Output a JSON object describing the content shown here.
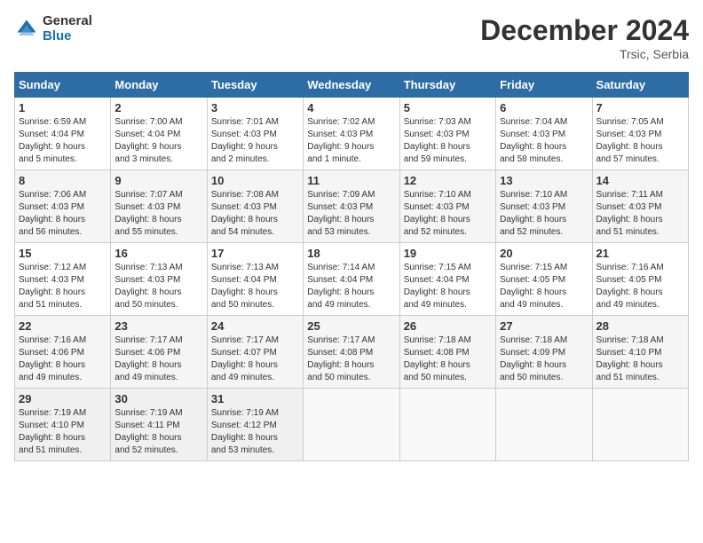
{
  "logo": {
    "general": "General",
    "blue": "Blue"
  },
  "title": "December 2024",
  "location": "Trsic, Serbia",
  "days_header": [
    "Sunday",
    "Monday",
    "Tuesday",
    "Wednesday",
    "Thursday",
    "Friday",
    "Saturday"
  ],
  "weeks": [
    [
      {
        "day": "1",
        "info": "Sunrise: 6:59 AM\nSunset: 4:04 PM\nDaylight: 9 hours\nand 5 minutes."
      },
      {
        "day": "2",
        "info": "Sunrise: 7:00 AM\nSunset: 4:04 PM\nDaylight: 9 hours\nand 3 minutes."
      },
      {
        "day": "3",
        "info": "Sunrise: 7:01 AM\nSunset: 4:03 PM\nDaylight: 9 hours\nand 2 minutes."
      },
      {
        "day": "4",
        "info": "Sunrise: 7:02 AM\nSunset: 4:03 PM\nDaylight: 9 hours\nand 1 minute."
      },
      {
        "day": "5",
        "info": "Sunrise: 7:03 AM\nSunset: 4:03 PM\nDaylight: 8 hours\nand 59 minutes."
      },
      {
        "day": "6",
        "info": "Sunrise: 7:04 AM\nSunset: 4:03 PM\nDaylight: 8 hours\nand 58 minutes."
      },
      {
        "day": "7",
        "info": "Sunrise: 7:05 AM\nSunset: 4:03 PM\nDaylight: 8 hours\nand 57 minutes."
      }
    ],
    [
      {
        "day": "8",
        "info": "Sunrise: 7:06 AM\nSunset: 4:03 PM\nDaylight: 8 hours\nand 56 minutes."
      },
      {
        "day": "9",
        "info": "Sunrise: 7:07 AM\nSunset: 4:03 PM\nDaylight: 8 hours\nand 55 minutes."
      },
      {
        "day": "10",
        "info": "Sunrise: 7:08 AM\nSunset: 4:03 PM\nDaylight: 8 hours\nand 54 minutes."
      },
      {
        "day": "11",
        "info": "Sunrise: 7:09 AM\nSunset: 4:03 PM\nDaylight: 8 hours\nand 53 minutes."
      },
      {
        "day": "12",
        "info": "Sunrise: 7:10 AM\nSunset: 4:03 PM\nDaylight: 8 hours\nand 52 minutes."
      },
      {
        "day": "13",
        "info": "Sunrise: 7:10 AM\nSunset: 4:03 PM\nDaylight: 8 hours\nand 52 minutes."
      },
      {
        "day": "14",
        "info": "Sunrise: 7:11 AM\nSunset: 4:03 PM\nDaylight: 8 hours\nand 51 minutes."
      }
    ],
    [
      {
        "day": "15",
        "info": "Sunrise: 7:12 AM\nSunset: 4:03 PM\nDaylight: 8 hours\nand 51 minutes."
      },
      {
        "day": "16",
        "info": "Sunrise: 7:13 AM\nSunset: 4:03 PM\nDaylight: 8 hours\nand 50 minutes."
      },
      {
        "day": "17",
        "info": "Sunrise: 7:13 AM\nSunset: 4:04 PM\nDaylight: 8 hours\nand 50 minutes."
      },
      {
        "day": "18",
        "info": "Sunrise: 7:14 AM\nSunset: 4:04 PM\nDaylight: 8 hours\nand 49 minutes."
      },
      {
        "day": "19",
        "info": "Sunrise: 7:15 AM\nSunset: 4:04 PM\nDaylight: 8 hours\nand 49 minutes."
      },
      {
        "day": "20",
        "info": "Sunrise: 7:15 AM\nSunset: 4:05 PM\nDaylight: 8 hours\nand 49 minutes."
      },
      {
        "day": "21",
        "info": "Sunrise: 7:16 AM\nSunset: 4:05 PM\nDaylight: 8 hours\nand 49 minutes."
      }
    ],
    [
      {
        "day": "22",
        "info": "Sunrise: 7:16 AM\nSunset: 4:06 PM\nDaylight: 8 hours\nand 49 minutes."
      },
      {
        "day": "23",
        "info": "Sunrise: 7:17 AM\nSunset: 4:06 PM\nDaylight: 8 hours\nand 49 minutes."
      },
      {
        "day": "24",
        "info": "Sunrise: 7:17 AM\nSunset: 4:07 PM\nDaylight: 8 hours\nand 49 minutes."
      },
      {
        "day": "25",
        "info": "Sunrise: 7:17 AM\nSunset: 4:08 PM\nDaylight: 8 hours\nand 50 minutes."
      },
      {
        "day": "26",
        "info": "Sunrise: 7:18 AM\nSunset: 4:08 PM\nDaylight: 8 hours\nand 50 minutes."
      },
      {
        "day": "27",
        "info": "Sunrise: 7:18 AM\nSunset: 4:09 PM\nDaylight: 8 hours\nand 50 minutes."
      },
      {
        "day": "28",
        "info": "Sunrise: 7:18 AM\nSunset: 4:10 PM\nDaylight: 8 hours\nand 51 minutes."
      }
    ],
    [
      {
        "day": "29",
        "info": "Sunrise: 7:19 AM\nSunset: 4:10 PM\nDaylight: 8 hours\nand 51 minutes."
      },
      {
        "day": "30",
        "info": "Sunrise: 7:19 AM\nSunset: 4:11 PM\nDaylight: 8 hours\nand 52 minutes."
      },
      {
        "day": "31",
        "info": "Sunrise: 7:19 AM\nSunset: 4:12 PM\nDaylight: 8 hours\nand 53 minutes."
      },
      {
        "day": "",
        "info": ""
      },
      {
        "day": "",
        "info": ""
      },
      {
        "day": "",
        "info": ""
      },
      {
        "day": "",
        "info": ""
      }
    ]
  ]
}
